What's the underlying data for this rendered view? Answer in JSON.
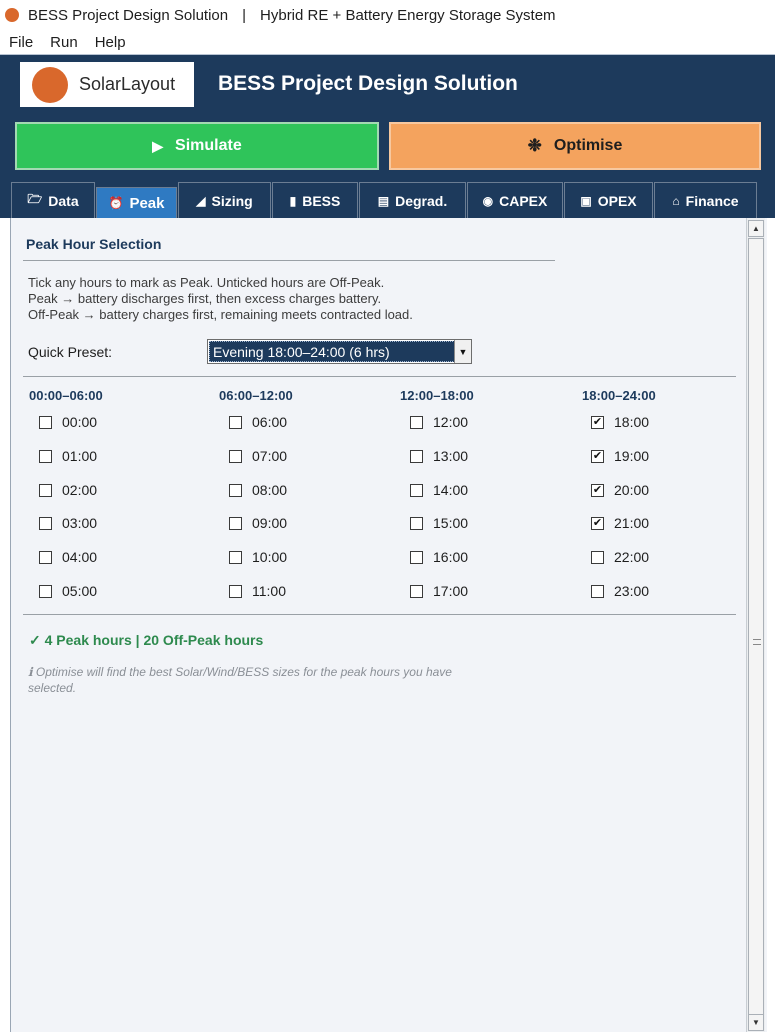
{
  "window": {
    "title": "BESS Project Design Solution",
    "separator": "|",
    "subtitle": "Hybrid RE + Battery Energy Storage System"
  },
  "menu": [
    "File",
    "Run",
    "Help"
  ],
  "header": {
    "logo_text": "SolarLayout",
    "app_title": "BESS Project Design Solution"
  },
  "actions": {
    "simulate_label": "Simulate",
    "simulate_icon": "play-icon",
    "optimise_label": "Optimise",
    "optimise_icon": "gear-icon"
  },
  "tabs": [
    {
      "label": "Data",
      "icon": "folder-icon",
      "active": false
    },
    {
      "label": "Peak",
      "icon": "alarm-clock-icon",
      "active": true
    },
    {
      "label": "Sizing",
      "icon": "ruler-icon",
      "active": false
    },
    {
      "label": "BESS",
      "icon": "battery-icon",
      "active": false
    },
    {
      "label": "Degrad.",
      "icon": "chart-icon",
      "active": false
    },
    {
      "label": "CAPEX",
      "icon": "money-bag-icon",
      "active": false
    },
    {
      "label": "OPEX",
      "icon": "toolbox-icon",
      "active": false
    },
    {
      "label": "Finance",
      "icon": "bank-icon",
      "active": false
    }
  ],
  "peak": {
    "section_title": "Peak Hour Selection",
    "help_lines": [
      "Tick any hours to mark as Peak.  Unticked hours are Off-Peak.",
      "Peak  → battery discharges first, then excess charges battery.",
      "Off-Peak → battery charges first, remaining meets contracted load."
    ],
    "preset_label": "Quick Preset:",
    "preset_value": "Evening  18:00–24:00  (6 hrs)",
    "columns": [
      {
        "heading": "00:00–06:00",
        "hours": [
          {
            "label": "00:00",
            "checked": false
          },
          {
            "label": "01:00",
            "checked": false
          },
          {
            "label": "02:00",
            "checked": false
          },
          {
            "label": "03:00",
            "checked": false
          },
          {
            "label": "04:00",
            "checked": false
          },
          {
            "label": "05:00",
            "checked": false
          }
        ]
      },
      {
        "heading": "06:00–12:00",
        "hours": [
          {
            "label": "06:00",
            "checked": false
          },
          {
            "label": "07:00",
            "checked": false
          },
          {
            "label": "08:00",
            "checked": false
          },
          {
            "label": "09:00",
            "checked": false
          },
          {
            "label": "10:00",
            "checked": false
          },
          {
            "label": "11:00",
            "checked": false
          }
        ]
      },
      {
        "heading": "12:00–18:00",
        "hours": [
          {
            "label": "12:00",
            "checked": false
          },
          {
            "label": "13:00",
            "checked": false
          },
          {
            "label": "14:00",
            "checked": false
          },
          {
            "label": "15:00",
            "checked": false
          },
          {
            "label": "16:00",
            "checked": false
          },
          {
            "label": "17:00",
            "checked": false
          }
        ]
      },
      {
        "heading": "18:00–24:00",
        "hours": [
          {
            "label": "18:00",
            "checked": true
          },
          {
            "label": "19:00",
            "checked": true
          },
          {
            "label": "20:00",
            "checked": true
          },
          {
            "label": "21:00",
            "checked": true
          },
          {
            "label": "22:00",
            "checked": false
          },
          {
            "label": "23:00",
            "checked": false
          }
        ]
      }
    ],
    "summary": "✓  4 Peak hours  |  20 Off-Peak hours",
    "note": "ℹ  Optimise will find the best Solar/Wind/BESS sizes for the peak hours you have selected."
  },
  "colors": {
    "header_bg": "#1d3a5c",
    "active_tab": "#2f7ac2",
    "simulate": "#2fc45a",
    "optimise": "#f4a35e",
    "summary": "#2e8a4e"
  }
}
